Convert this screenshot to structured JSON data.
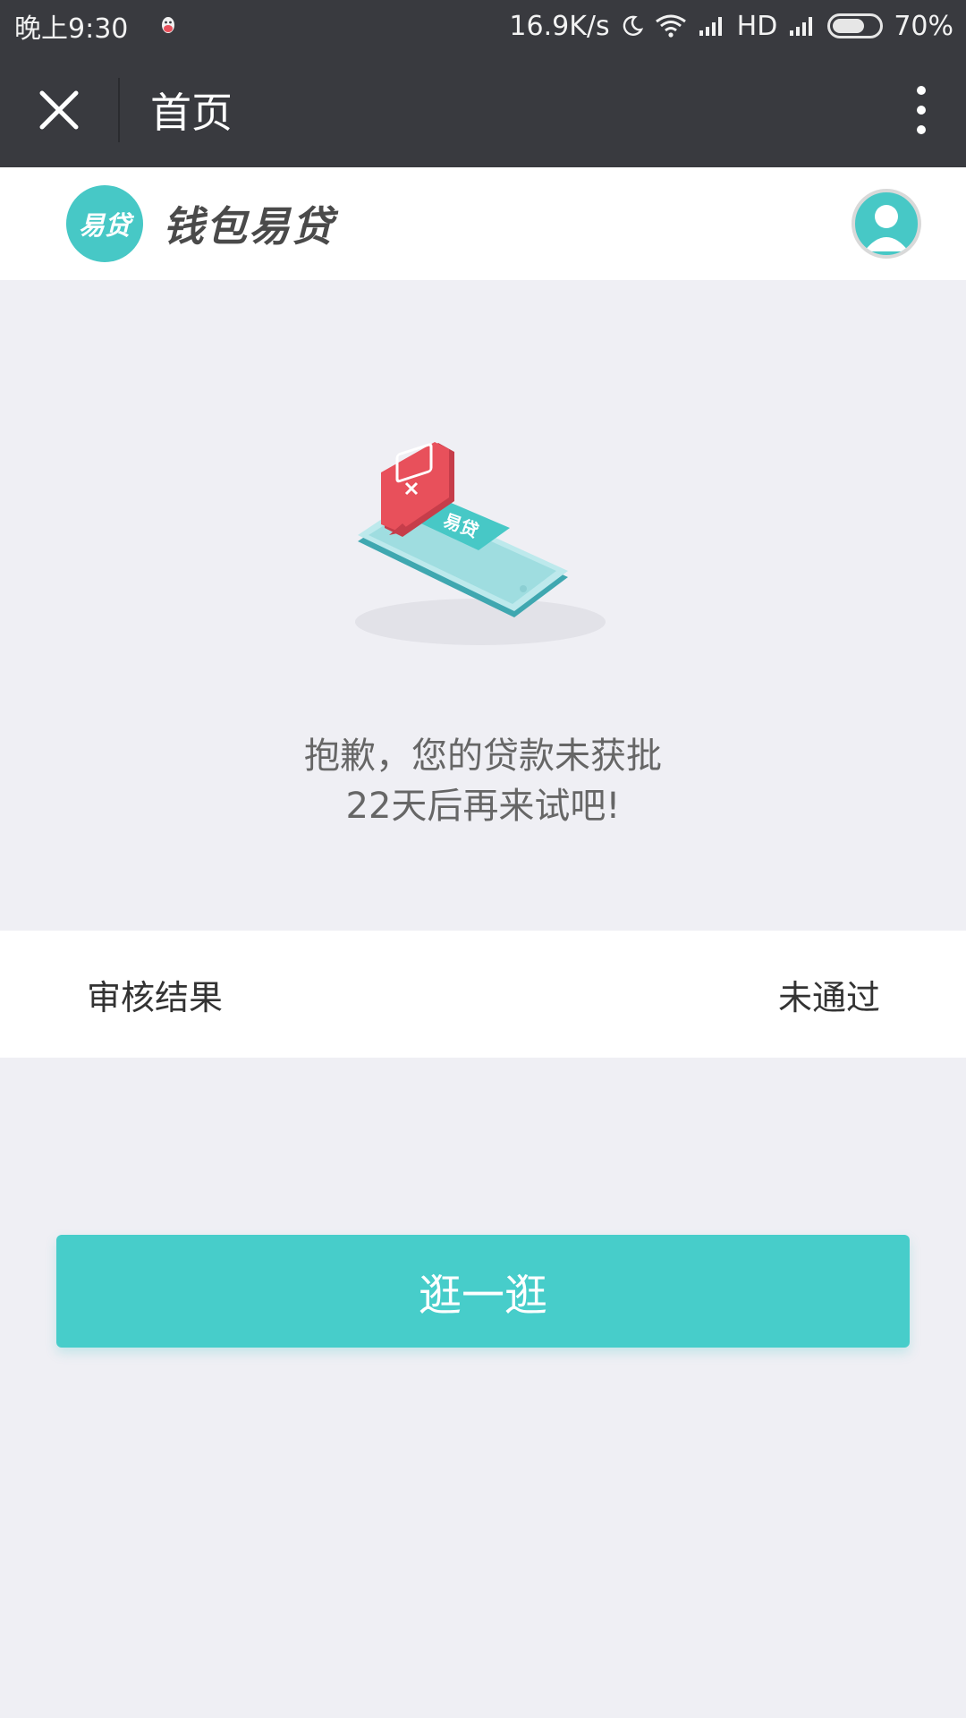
{
  "status_bar": {
    "time": "晚上9:30",
    "network_speed": "16.9K/s",
    "network_type": "HD",
    "battery": "70%"
  },
  "nav": {
    "title": "首页"
  },
  "header": {
    "logo_text": "易贷",
    "brand_name": "钱包易贷"
  },
  "illustration": {
    "phone_label": "易贷"
  },
  "message": {
    "line1": "抱歉，您的贷款未获批",
    "line2": "22天后再来试吧!"
  },
  "result": {
    "label": "审核结果",
    "value": "未通过"
  },
  "button": {
    "label": "逛一逛"
  },
  "colors": {
    "accent": "#47cdca",
    "topbar": "#393a3f",
    "background": "#efeff4",
    "alert": "#e8505b"
  }
}
